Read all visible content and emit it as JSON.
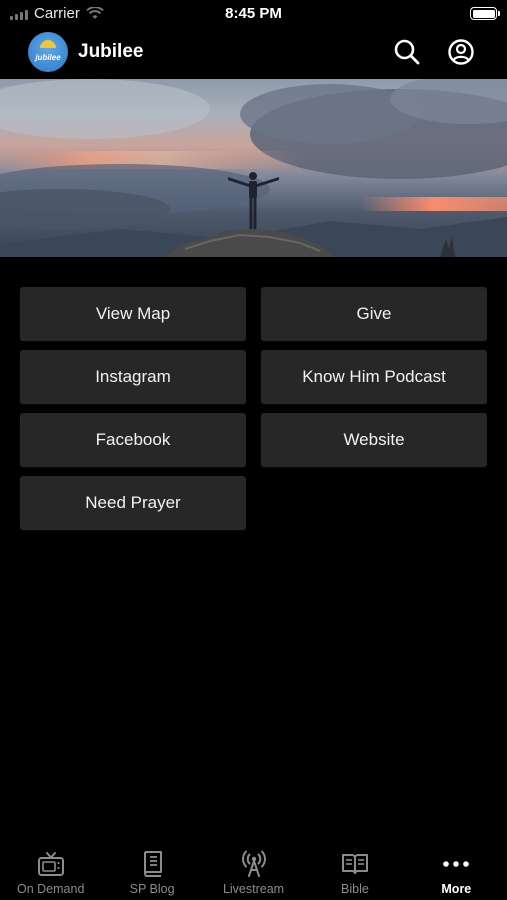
{
  "status_bar": {
    "carrier": "Carrier",
    "time": "8:45 PM"
  },
  "header": {
    "title": "Jubilee",
    "logo_text": "jubilee"
  },
  "menu": {
    "items": [
      {
        "label": "View Map"
      },
      {
        "label": "Give"
      },
      {
        "label": "Instagram"
      },
      {
        "label": "Know Him Podcast"
      },
      {
        "label": "Facebook"
      },
      {
        "label": "Website"
      },
      {
        "label": "Need Prayer"
      }
    ]
  },
  "tab_bar": {
    "tabs": [
      {
        "label": "On Demand",
        "icon": "tv-icon"
      },
      {
        "label": "SP Blog",
        "icon": "book-icon"
      },
      {
        "label": "Livestream",
        "icon": "broadcast-icon"
      },
      {
        "label": "Bible",
        "icon": "open-book-icon"
      },
      {
        "label": "More",
        "icon": "more-icon"
      }
    ],
    "active": "More"
  },
  "colors": {
    "background": "#000000",
    "tile": "#272727",
    "inactive_tab": "#8c8c8c",
    "active_tab": "#ffffff"
  }
}
